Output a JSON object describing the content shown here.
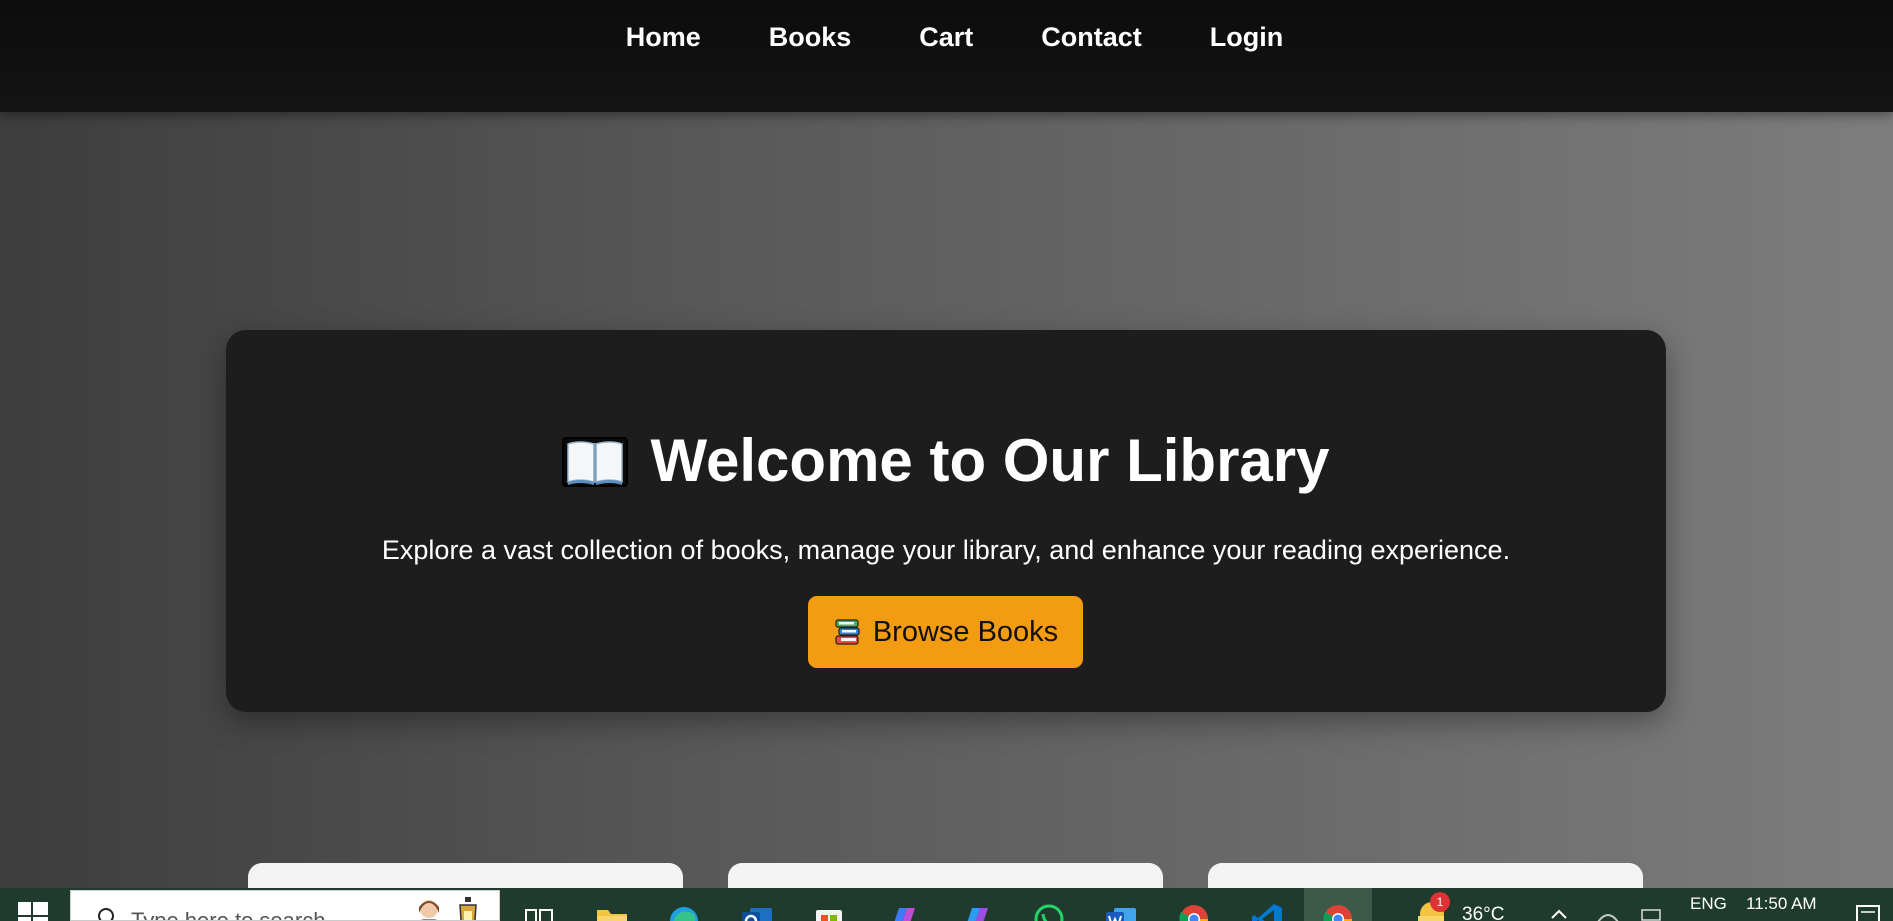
{
  "nav": {
    "links": [
      "Home",
      "Books",
      "Cart",
      "Contact",
      "Login"
    ]
  },
  "hero": {
    "title": "Welcome to Our Library",
    "subtitle": "Explore a vast collection of books, manage your library, and enhance your reading experience.",
    "button_label": "Browse Books"
  },
  "taskbar": {
    "search_placeholder": "Type here to search",
    "weather_badge": "1",
    "temperature": "36°C",
    "language": "ENG",
    "time": "11:50 AM"
  },
  "colors": {
    "accent": "#f39c12",
    "navbar": "#111111",
    "card": "#1d1d1d"
  },
  "icons": [
    "open-book-icon",
    "books-stack-icon",
    "windows-start-icon",
    "search-icon",
    "task-view-icon",
    "file-explorer-icon",
    "edge-icon",
    "outlook-icon",
    "store-icon",
    "copilot-icon",
    "whatsapp-icon",
    "word-icon",
    "chrome-icon",
    "vscode-icon"
  ]
}
